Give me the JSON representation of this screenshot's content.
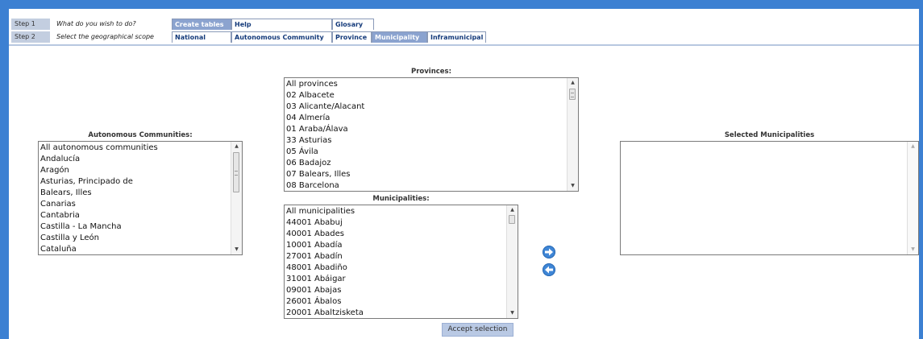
{
  "steps": [
    {
      "label": "Step 1",
      "question": "What do you wish to do?"
    },
    {
      "label": "Step 2",
      "question": "Select the geographical scope"
    }
  ],
  "step1_tabs": [
    "Create tables",
    "Help",
    "Glosary"
  ],
  "step2_tabs": [
    "National",
    "Autonomous Community",
    "Province",
    "Municipality",
    "Inframunicipal"
  ],
  "active_tabs": {
    "step1": "Create tables",
    "step2": "Municipality"
  },
  "autonomous": {
    "title": "Autonomous Communities:",
    "items": [
      "All autonomous communities",
      "Andalucía",
      "Aragón",
      "Asturias, Principado de",
      "Balears, Illes",
      "Canarias",
      "Cantabria",
      "Castilla - La Mancha",
      "Castilla y León",
      "Cataluña"
    ]
  },
  "provinces": {
    "title": "Provinces:",
    "items": [
      "All provinces",
      "02 Albacete",
      "03 Alicante/Alacant",
      "04 Almería",
      "01 Araba/Álava",
      "33 Asturias",
      "05 Ávila",
      "06 Badajoz",
      "07 Balears, Illes",
      "08 Barcelona"
    ]
  },
  "municipalities": {
    "title": "Municipalities:",
    "items": [
      "All municipalities",
      "44001 Ababuj",
      "40001 Abades",
      "10001 Abadía",
      "27001 Abadín",
      "48001 Abadiño",
      "31001 Abáigar",
      "09001 Abajas",
      "26001 Ábalos",
      "20001 Abaltzisketa"
    ]
  },
  "selected": {
    "title": "Selected Municipalities",
    "items": []
  },
  "accept_label": "Accept selection",
  "colors": {
    "frame": "#3c80d2",
    "active_tab": "#8ba3cf",
    "step_label": "#c3cee0",
    "arrow": "#3f86d6"
  }
}
